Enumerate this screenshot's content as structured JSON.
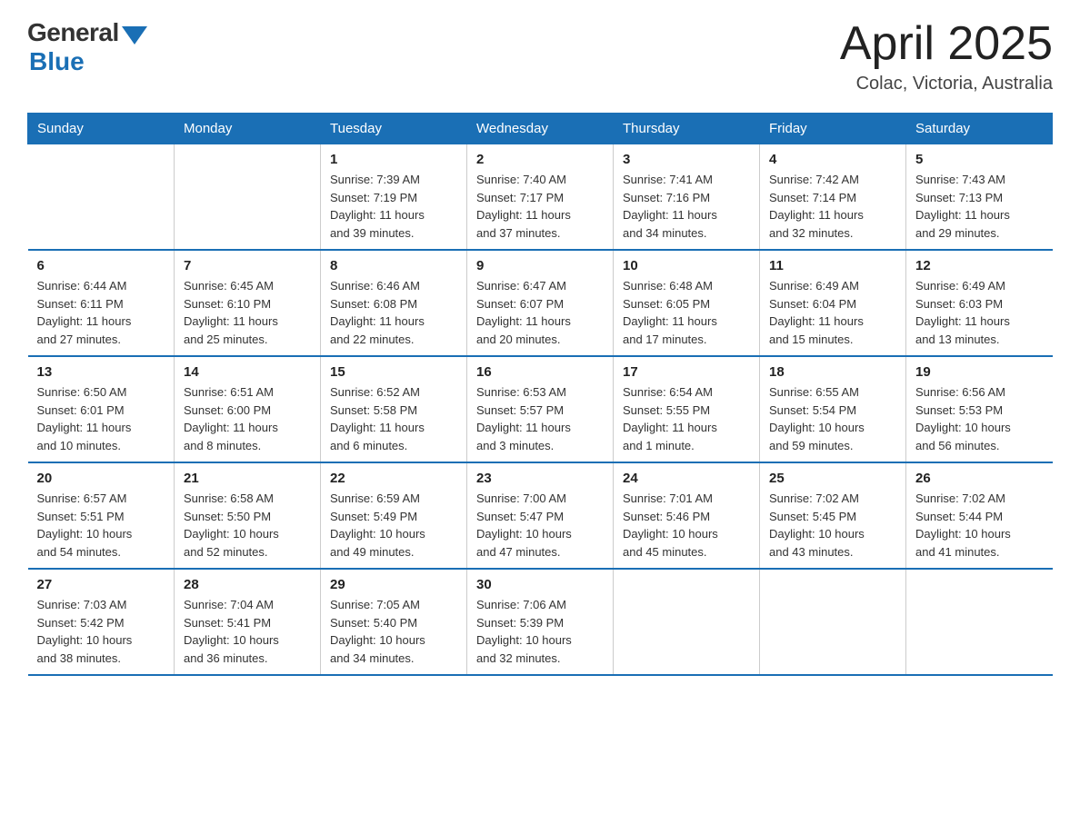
{
  "header": {
    "logo_general": "General",
    "logo_blue": "Blue",
    "month_title": "April 2025",
    "location": "Colac, Victoria, Australia"
  },
  "days_of_week": [
    "Sunday",
    "Monday",
    "Tuesday",
    "Wednesday",
    "Thursday",
    "Friday",
    "Saturday"
  ],
  "weeks": [
    [
      {
        "day": "",
        "info": ""
      },
      {
        "day": "",
        "info": ""
      },
      {
        "day": "1",
        "info": "Sunrise: 7:39 AM\nSunset: 7:19 PM\nDaylight: 11 hours\nand 39 minutes."
      },
      {
        "day": "2",
        "info": "Sunrise: 7:40 AM\nSunset: 7:17 PM\nDaylight: 11 hours\nand 37 minutes."
      },
      {
        "day": "3",
        "info": "Sunrise: 7:41 AM\nSunset: 7:16 PM\nDaylight: 11 hours\nand 34 minutes."
      },
      {
        "day": "4",
        "info": "Sunrise: 7:42 AM\nSunset: 7:14 PM\nDaylight: 11 hours\nand 32 minutes."
      },
      {
        "day": "5",
        "info": "Sunrise: 7:43 AM\nSunset: 7:13 PM\nDaylight: 11 hours\nand 29 minutes."
      }
    ],
    [
      {
        "day": "6",
        "info": "Sunrise: 6:44 AM\nSunset: 6:11 PM\nDaylight: 11 hours\nand 27 minutes."
      },
      {
        "day": "7",
        "info": "Sunrise: 6:45 AM\nSunset: 6:10 PM\nDaylight: 11 hours\nand 25 minutes."
      },
      {
        "day": "8",
        "info": "Sunrise: 6:46 AM\nSunset: 6:08 PM\nDaylight: 11 hours\nand 22 minutes."
      },
      {
        "day": "9",
        "info": "Sunrise: 6:47 AM\nSunset: 6:07 PM\nDaylight: 11 hours\nand 20 minutes."
      },
      {
        "day": "10",
        "info": "Sunrise: 6:48 AM\nSunset: 6:05 PM\nDaylight: 11 hours\nand 17 minutes."
      },
      {
        "day": "11",
        "info": "Sunrise: 6:49 AM\nSunset: 6:04 PM\nDaylight: 11 hours\nand 15 minutes."
      },
      {
        "day": "12",
        "info": "Sunrise: 6:49 AM\nSunset: 6:03 PM\nDaylight: 11 hours\nand 13 minutes."
      }
    ],
    [
      {
        "day": "13",
        "info": "Sunrise: 6:50 AM\nSunset: 6:01 PM\nDaylight: 11 hours\nand 10 minutes."
      },
      {
        "day": "14",
        "info": "Sunrise: 6:51 AM\nSunset: 6:00 PM\nDaylight: 11 hours\nand 8 minutes."
      },
      {
        "day": "15",
        "info": "Sunrise: 6:52 AM\nSunset: 5:58 PM\nDaylight: 11 hours\nand 6 minutes."
      },
      {
        "day": "16",
        "info": "Sunrise: 6:53 AM\nSunset: 5:57 PM\nDaylight: 11 hours\nand 3 minutes."
      },
      {
        "day": "17",
        "info": "Sunrise: 6:54 AM\nSunset: 5:55 PM\nDaylight: 11 hours\nand 1 minute."
      },
      {
        "day": "18",
        "info": "Sunrise: 6:55 AM\nSunset: 5:54 PM\nDaylight: 10 hours\nand 59 minutes."
      },
      {
        "day": "19",
        "info": "Sunrise: 6:56 AM\nSunset: 5:53 PM\nDaylight: 10 hours\nand 56 minutes."
      }
    ],
    [
      {
        "day": "20",
        "info": "Sunrise: 6:57 AM\nSunset: 5:51 PM\nDaylight: 10 hours\nand 54 minutes."
      },
      {
        "day": "21",
        "info": "Sunrise: 6:58 AM\nSunset: 5:50 PM\nDaylight: 10 hours\nand 52 minutes."
      },
      {
        "day": "22",
        "info": "Sunrise: 6:59 AM\nSunset: 5:49 PM\nDaylight: 10 hours\nand 49 minutes."
      },
      {
        "day": "23",
        "info": "Sunrise: 7:00 AM\nSunset: 5:47 PM\nDaylight: 10 hours\nand 47 minutes."
      },
      {
        "day": "24",
        "info": "Sunrise: 7:01 AM\nSunset: 5:46 PM\nDaylight: 10 hours\nand 45 minutes."
      },
      {
        "day": "25",
        "info": "Sunrise: 7:02 AM\nSunset: 5:45 PM\nDaylight: 10 hours\nand 43 minutes."
      },
      {
        "day": "26",
        "info": "Sunrise: 7:02 AM\nSunset: 5:44 PM\nDaylight: 10 hours\nand 41 minutes."
      }
    ],
    [
      {
        "day": "27",
        "info": "Sunrise: 7:03 AM\nSunset: 5:42 PM\nDaylight: 10 hours\nand 38 minutes."
      },
      {
        "day": "28",
        "info": "Sunrise: 7:04 AM\nSunset: 5:41 PM\nDaylight: 10 hours\nand 36 minutes."
      },
      {
        "day": "29",
        "info": "Sunrise: 7:05 AM\nSunset: 5:40 PM\nDaylight: 10 hours\nand 34 minutes."
      },
      {
        "day": "30",
        "info": "Sunrise: 7:06 AM\nSunset: 5:39 PM\nDaylight: 10 hours\nand 32 minutes."
      },
      {
        "day": "",
        "info": ""
      },
      {
        "day": "",
        "info": ""
      },
      {
        "day": "",
        "info": ""
      }
    ]
  ]
}
